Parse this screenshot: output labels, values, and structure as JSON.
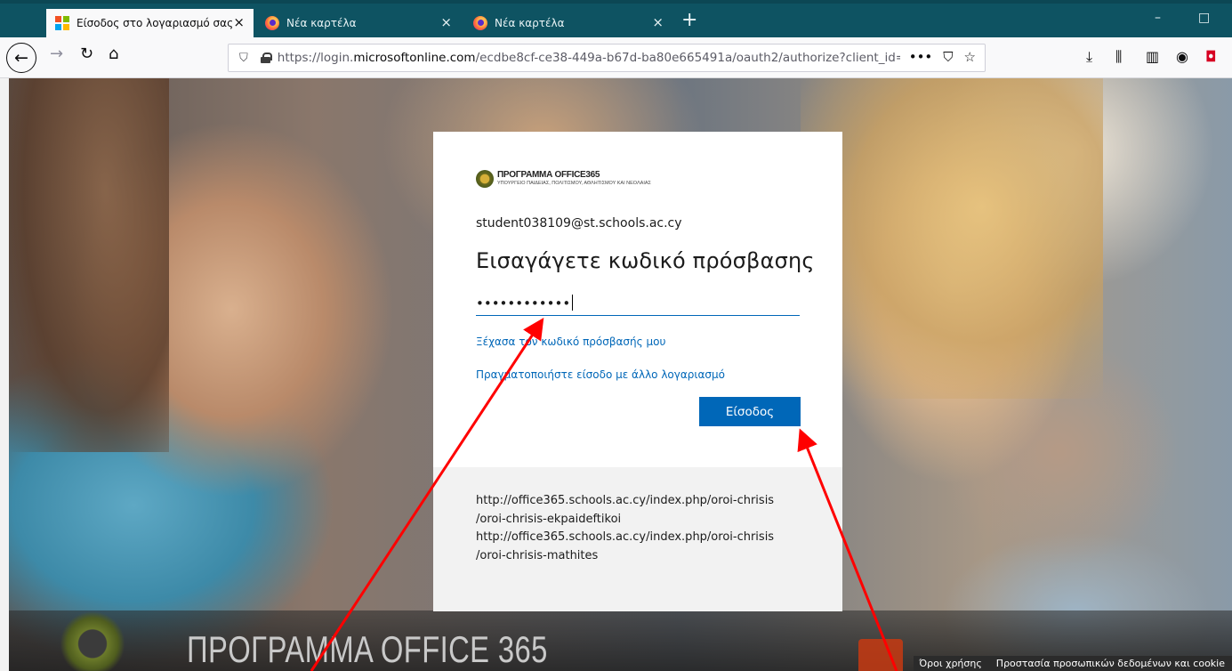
{
  "browser": {
    "tabs": [
      {
        "label": "Είσοδος στο λογαριασμό σας",
        "close": "×",
        "active": true,
        "icon": "microsoft-icon"
      },
      {
        "label": "Νέα καρτέλα",
        "close": "×",
        "active": false,
        "icon": "firefox-icon"
      },
      {
        "label": "Νέα καρτέλα",
        "close": "×",
        "active": false,
        "icon": "firefox-icon"
      }
    ],
    "new_tab": "+",
    "window_controls": {
      "minimize": "–",
      "maximize": "□"
    },
    "url": {
      "prefix": "https://login.",
      "domain": "microsoftonline.com",
      "path": "/ecdbe8cf-ce38-449a-b67d-ba80e665491a/oauth2/authorize?client_id="
    },
    "url_actions": {
      "more": "•••",
      "pocket": "⛉",
      "bookmark": "☆"
    },
    "toolbar": {
      "downloads": "⤓",
      "library": "⫼",
      "sidebar": "▥",
      "account": "◉",
      "extension": "◘"
    },
    "nav": {
      "back": "←",
      "forward": "→",
      "reload": "↻",
      "home": "⌂"
    }
  },
  "login": {
    "org_name": "ΠΡΟΓΡΑΜΜΑ OFFICE365",
    "org_sub": "ΥΠΟΥΡΓΕΙΟ ΠΑΙΔΕΙΑΣ, ΠΟΛΙΤΙΣΜΟΥ, ΑΘΛΗΤΙΣΜΟΥ ΚΑΙ ΝΕΟΛΑΙΑΣ",
    "username": "student038109@st.schools.ac.cy",
    "heading": "Εισαγάγετε κωδικό πρόσβασης",
    "password_masked": "••••••••••••",
    "forgot_link": "Ξέχασα τον κωδικό πρόσβασής μου",
    "other_account_link": "Πραγματοποιήστε είσοδο με άλλο λογαριασμό",
    "signin_button": "Είσοδος",
    "footer_lines": [
      "http://office365.schools.ac.cy/index.php/oroi-chrisis",
      "/oroi-chrisis-ekpaideftikoi",
      "http://office365.schools.ac.cy/index.php/oroi-chrisis",
      "/oroi-chrisis-mathites"
    ]
  },
  "background": {
    "title": "ΠΡΟΓΡΑΜΜΑ OFFICE 365",
    "footer_links": [
      "Όροι χρήσης",
      "Προστασία προσωπικών δεδομένων και cookie"
    ]
  },
  "colors": {
    "accent": "#0067b8",
    "tab_bar": "#0e5362",
    "annotation": "#ff0000"
  }
}
